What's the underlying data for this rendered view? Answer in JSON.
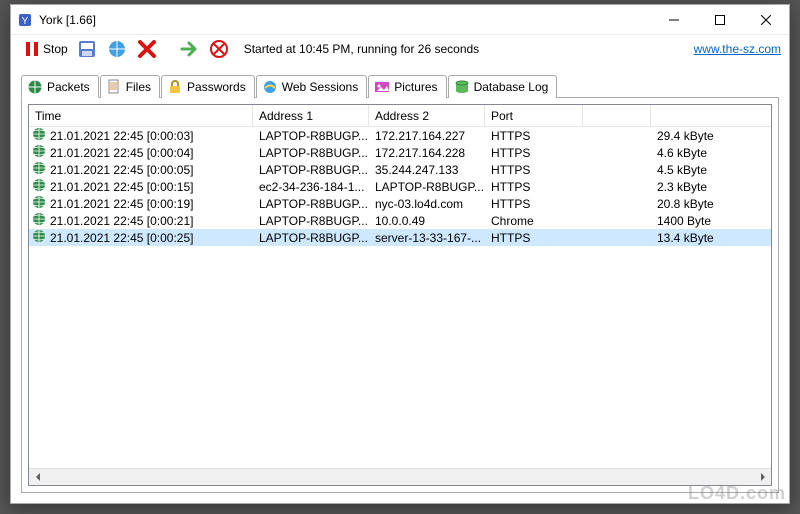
{
  "window": {
    "title": "York [1.66]"
  },
  "toolbar": {
    "stop_label": "Stop",
    "status": "Started at 10:45 PM, running for 26 seconds",
    "link_label": "www.the-sz.com"
  },
  "tabs": {
    "packets": "Packets",
    "files": "Files",
    "passwords": "Passwords",
    "websessions": "Web Sessions",
    "pictures": "Pictures",
    "dblog": "Database Log"
  },
  "columns": {
    "time": "Time",
    "addr1": "Address 1",
    "addr2": "Address 2",
    "port": "Port",
    "size": ""
  },
  "rows": [
    {
      "time": "21.01.2021 22:45 [0:00:03]",
      "a1": "LAPTOP-R8BUGP...",
      "a2": "172.217.164.227",
      "port": "HTTPS",
      "size": "29.4 kByte",
      "sel": false
    },
    {
      "time": "21.01.2021 22:45 [0:00:04]",
      "a1": "LAPTOP-R8BUGP...",
      "a2": "172.217.164.228",
      "port": "HTTPS",
      "size": "4.6 kByte",
      "sel": false
    },
    {
      "time": "21.01.2021 22:45 [0:00:05]",
      "a1": "LAPTOP-R8BUGP...",
      "a2": "35.244.247.133",
      "port": "HTTPS",
      "size": "4.5 kByte",
      "sel": false
    },
    {
      "time": "21.01.2021 22:45 [0:00:15]",
      "a1": "ec2-34-236-184-1...",
      "a2": "LAPTOP-R8BUGP...",
      "port": "HTTPS",
      "size": "2.3 kByte",
      "sel": false
    },
    {
      "time": "21.01.2021 22:45 [0:00:19]",
      "a1": "LAPTOP-R8BUGP...",
      "a2": "nyc-03.lo4d.com",
      "port": "HTTPS",
      "size": "20.8 kByte",
      "sel": false
    },
    {
      "time": "21.01.2021 22:45 [0:00:21]",
      "a1": "LAPTOP-R8BUGP...",
      "a2": "10.0.0.49",
      "port": "Chrome",
      "size": "1400 Byte",
      "sel": false
    },
    {
      "time": "21.01.2021 22:45 [0:00:25]",
      "a1": "LAPTOP-R8BUGP...",
      "a2": "server-13-33-167-...",
      "port": "HTTPS",
      "size": "13.4 kByte",
      "sel": true
    }
  ],
  "watermark": "LO4D.com"
}
